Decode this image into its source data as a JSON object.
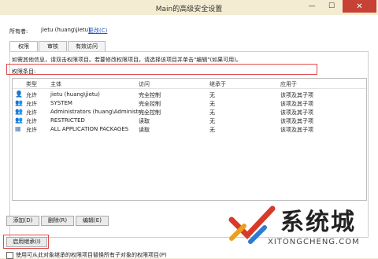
{
  "window": {
    "title": "Main的高级安全设置",
    "min_glyph": "—",
    "max_glyph": "☐",
    "close_glyph": "✕"
  },
  "owner": {
    "label": "所有者:",
    "value": "jietu (huang\\jietu)",
    "change_link": "更改(C)"
  },
  "tabs": [
    {
      "label": "权限",
      "active": true
    },
    {
      "label": "审核",
      "active": false
    },
    {
      "label": "有效访问",
      "active": false
    }
  ],
  "info_text": "如需其他信息，请双击权限项目。若要修改权限项目，请选择该项目并单击\"编辑\"(如果可用)。",
  "entries_label": "权限条目:",
  "table": {
    "columns": [
      "类型",
      "主体",
      "访问",
      "继承于",
      "应用于"
    ],
    "rows": [
      {
        "type": "允许",
        "principal": "jietu (huang\\jietu)",
        "access": "完全控制",
        "inherited": "无",
        "applies": "该项及其子项"
      },
      {
        "type": "允许",
        "principal": "SYSTEM",
        "access": "完全控制",
        "inherited": "无",
        "applies": "该项及其子项"
      },
      {
        "type": "允许",
        "principal": "Administrators (huang\\Administr...",
        "access": "完全控制",
        "inherited": "无",
        "applies": "该项及其子项"
      },
      {
        "type": "允许",
        "principal": "RESTRICTED",
        "access": "读取",
        "inherited": "无",
        "applies": "该项及其子项"
      },
      {
        "type": "允许",
        "principal": "ALL APPLICATION PACKAGES",
        "access": "读取",
        "inherited": "无",
        "applies": "该项及其子项"
      }
    ]
  },
  "buttons": {
    "add": "添加(D)",
    "delete": "删除(R)",
    "edit": "编辑(E)",
    "enable_inheritance": "启用继承(I)"
  },
  "checkbox_label": "使用可从此对象继承的权限项目替换所有子对象的权限项目(P)",
  "watermark": {
    "text": "系统城",
    "url": "XITONGCHENG.COM"
  }
}
